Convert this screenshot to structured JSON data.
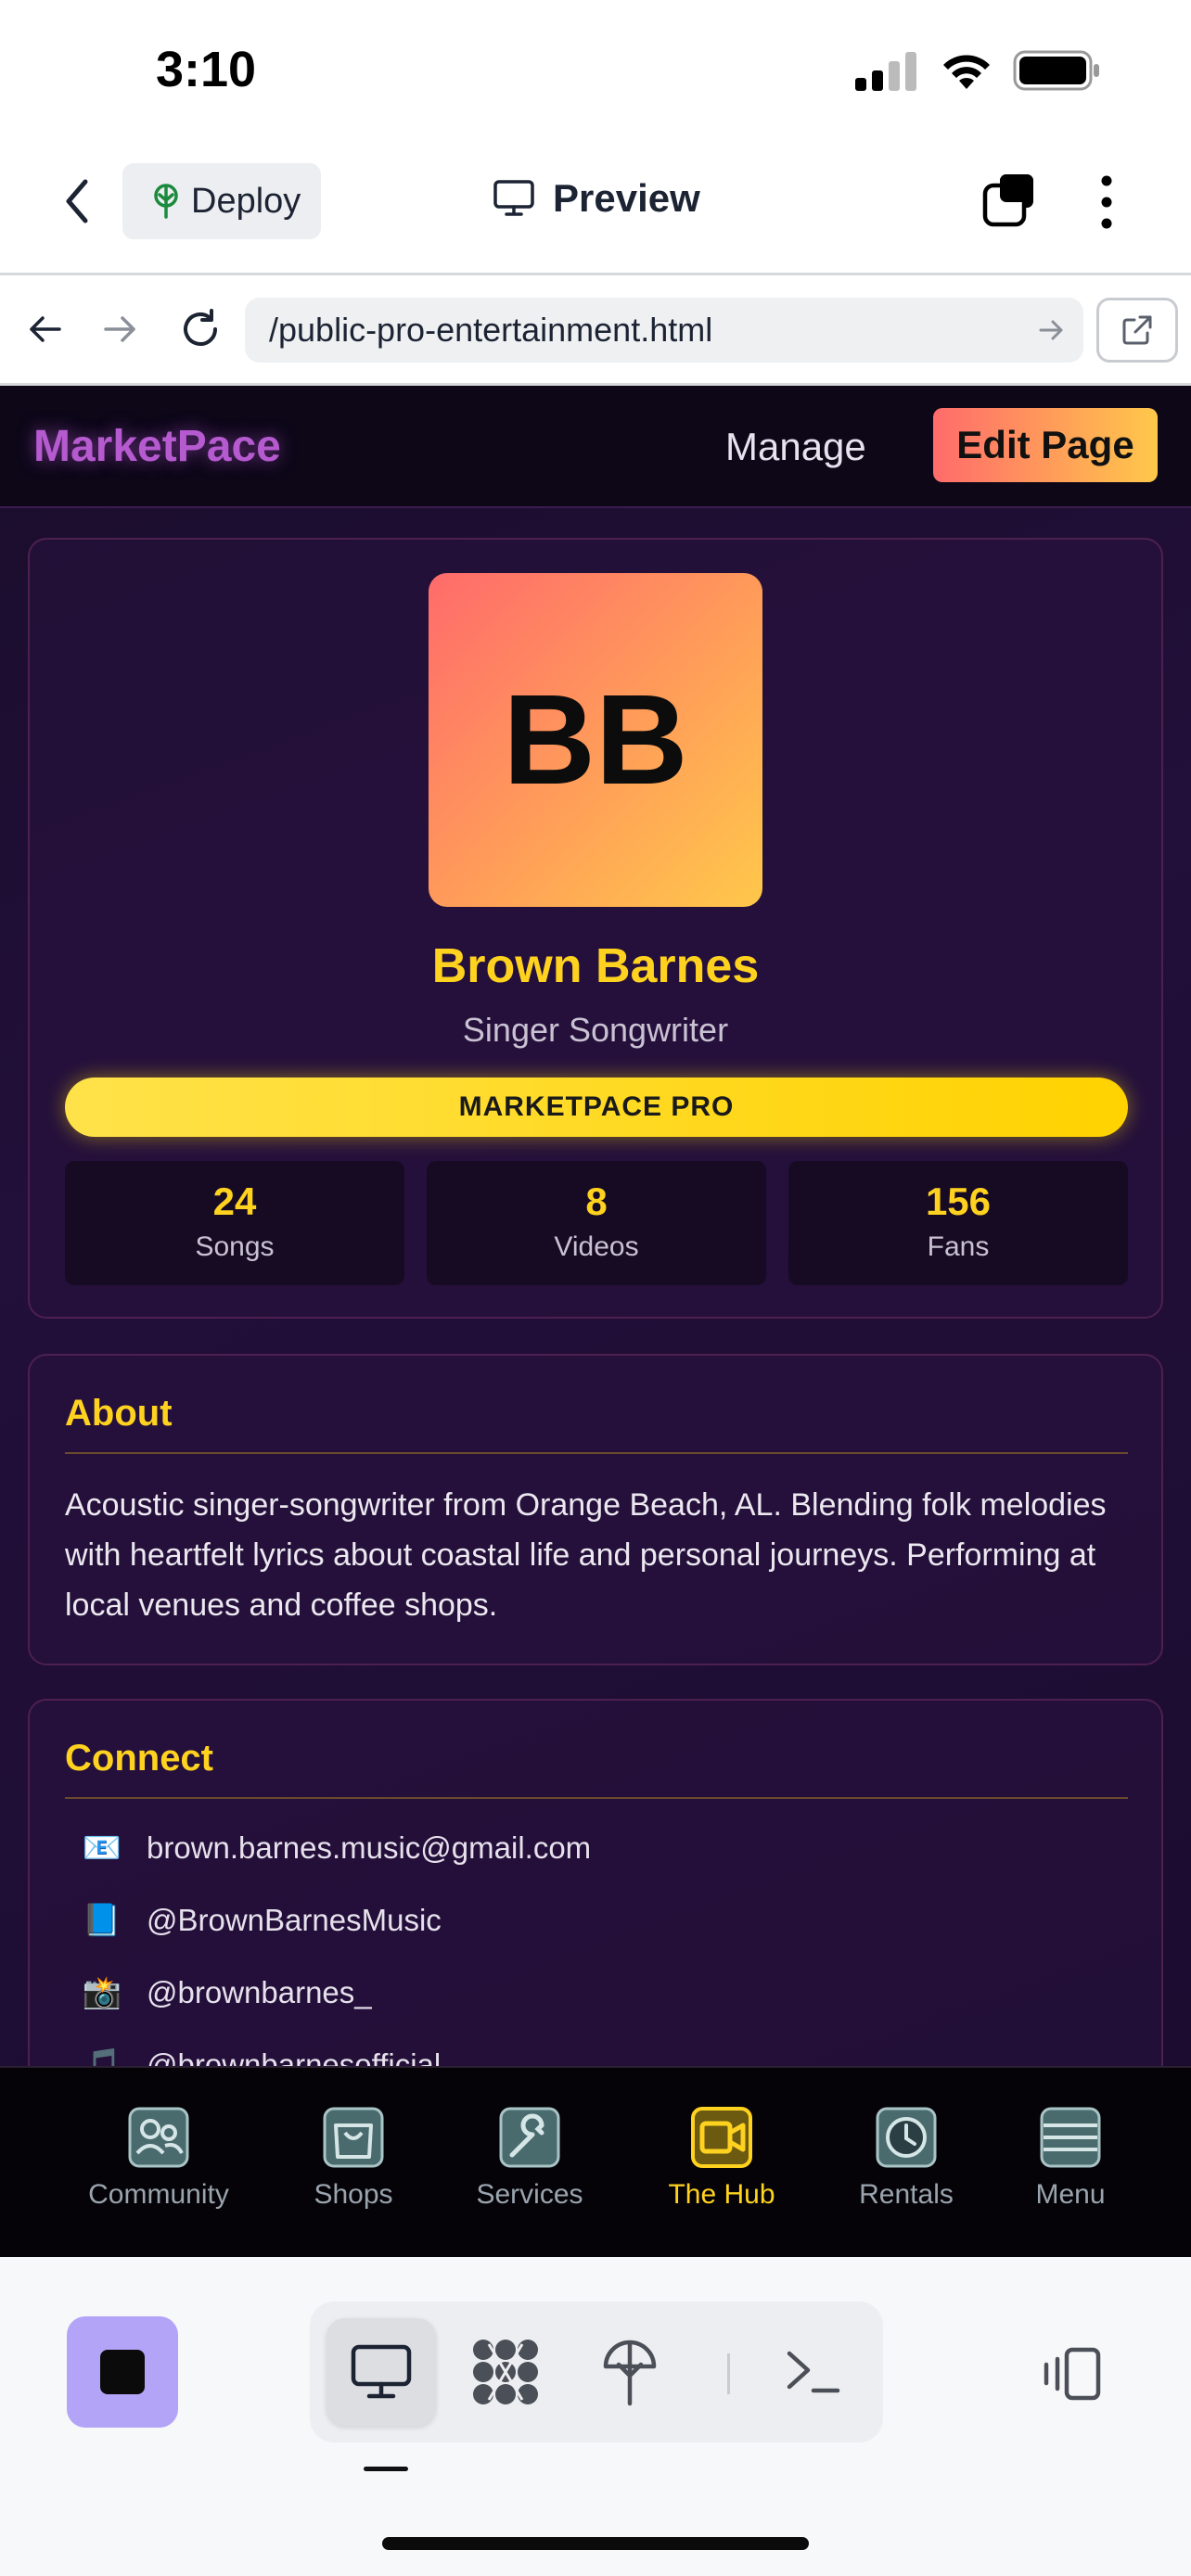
{
  "status_bar": {
    "time": "3:10"
  },
  "app_bar": {
    "deploy_label": "Deploy",
    "title": "Preview"
  },
  "url_bar": {
    "url": "/public-pro-entertainment.html"
  },
  "site": {
    "brand": "MarketPace",
    "nav": {
      "manage": "Manage",
      "edit_page": "Edit Page"
    },
    "profile": {
      "initials": "BB",
      "name": "Brown Barnes",
      "subtitle": "Singer Songwriter",
      "badge": "MARKETPACE PRO",
      "stats": [
        {
          "value": "24",
          "label": "Songs"
        },
        {
          "value": "8",
          "label": "Videos"
        },
        {
          "value": "156",
          "label": "Fans"
        }
      ]
    },
    "about": {
      "title": "About",
      "text": "Acoustic singer-songwriter from Orange Beach, AL. Blending folk melodies with heartfelt lyrics about coastal life and personal journeys. Performing at local venues and coffee shops."
    },
    "connect": {
      "title": "Connect",
      "items": [
        {
          "icon": "envelope-icon",
          "glyph": "📧",
          "text": "brown.barnes.music@gmail.com"
        },
        {
          "icon": "book-icon",
          "glyph": "📘",
          "text": "@BrownBarnesMusic"
        },
        {
          "icon": "camera-flash-icon",
          "glyph": "📸",
          "text": "@brownbarnes_"
        },
        {
          "icon": "music-note-icon",
          "glyph": "🎵",
          "text": "@brownbarnesofficial"
        }
      ]
    },
    "tabbar": [
      {
        "label": "Community",
        "icon": "community-icon"
      },
      {
        "label": "Shops",
        "icon": "shopping-bag-icon"
      },
      {
        "label": "Services",
        "icon": "wrench-icon"
      },
      {
        "label": "The Hub",
        "icon": "video-camera-icon",
        "active": true
      },
      {
        "label": "Rentals",
        "icon": "clock-icon"
      },
      {
        "label": "Menu",
        "icon": "menu-icon"
      }
    ]
  },
  "colors": {
    "accent_gold": "#ffd21f",
    "brand_purple": "#b65ad0",
    "stop_button": "#b3a4f7"
  }
}
